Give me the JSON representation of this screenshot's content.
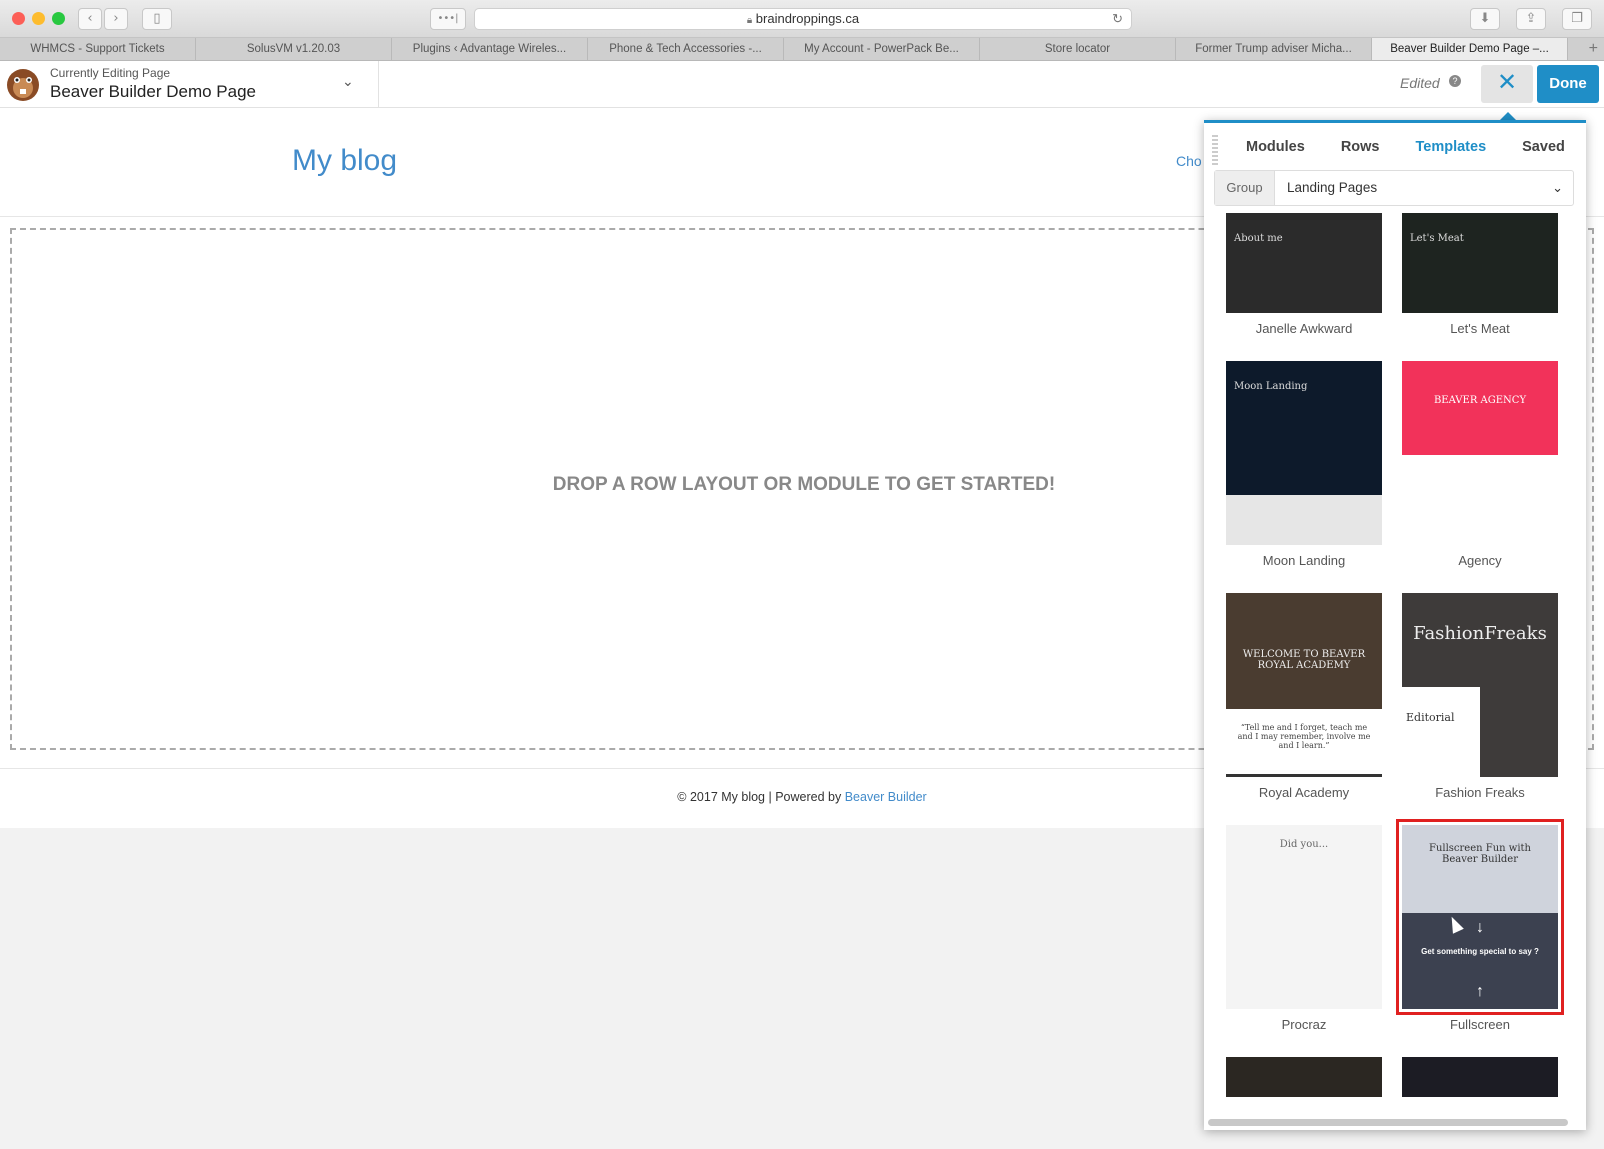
{
  "browser": {
    "url": "braindroppings.ca",
    "tabs": [
      {
        "label": "WHMCS - Support Tickets",
        "width": 198
      },
      {
        "label": "SolusVM v1.20.03",
        "width": 198
      },
      {
        "label": "Plugins ‹ Advantage Wireles...",
        "width": 198
      },
      {
        "label": "Phone & Tech Accessories -...",
        "width": 198
      },
      {
        "label": "My Account - PowerPack Be...",
        "width": 198
      },
      {
        "label": "Store locator",
        "width": 198
      },
      {
        "label": "Former Trump adviser Micha...",
        "width": 198
      },
      {
        "label": "Beaver Builder Demo Page –...",
        "width": 198
      }
    ],
    "tab_plus": "+",
    "dots": "•••|"
  },
  "bbbar": {
    "currently_editing": "Currently Editing Page",
    "page_title": "Beaver Builder Demo Page",
    "edited": "Edited",
    "help": "?",
    "close": "✕",
    "done": "Done"
  },
  "page": {
    "blog_title": "My blog",
    "cho": "Cho",
    "drop_message": "DROP A ROW LAYOUT OR MODULE TO GET STARTED!",
    "footer_prefix": "© 2017 My blog | Powered by ",
    "footer_link": "Beaver Builder"
  },
  "panel": {
    "tabs": [
      "Modules",
      "Rows",
      "Templates",
      "Saved"
    ],
    "active_tab": "Templates",
    "group_label": "Group",
    "group_value": "Landing Pages",
    "templates": [
      {
        "name": "Janelle Awkward",
        "bg": "#2b2b2b",
        "thumb_text": "About me"
      },
      {
        "name": "Let's Meat",
        "bg": "#1e2420",
        "thumb_text": "Let's Meat"
      },
      {
        "name": "Moon Landing",
        "bg": "#0d1a2b",
        "thumb_text": "Moon Landing"
      },
      {
        "name": "Agency",
        "bg": "#f2325a",
        "thumb_text": "BEAVER AGENCY"
      },
      {
        "name": "Royal Academy",
        "bg": "#4a3c30",
        "thumb_text": "WELCOME TO BEAVER ROYAL ACADEMY"
      },
      {
        "name": "Fashion Freaks",
        "bg": "#3e3b3a",
        "thumb_text": "FashionFreaks"
      },
      {
        "name": "Procraz",
        "bg": "#f4f4f4",
        "thumb_text": "Did you..."
      },
      {
        "name": "Fullscreen",
        "bg": "#3c4150",
        "thumb_text": "Fullscreen Fun with Beaver Builder"
      }
    ],
    "royal_quote": "“Tell me and I forget, teach me and I may remember, involve me and I learn.”",
    "fashion_editorial": "Editorial",
    "fullscreen_sub": "Get something special to say ?",
    "selected": "Fullscreen"
  }
}
